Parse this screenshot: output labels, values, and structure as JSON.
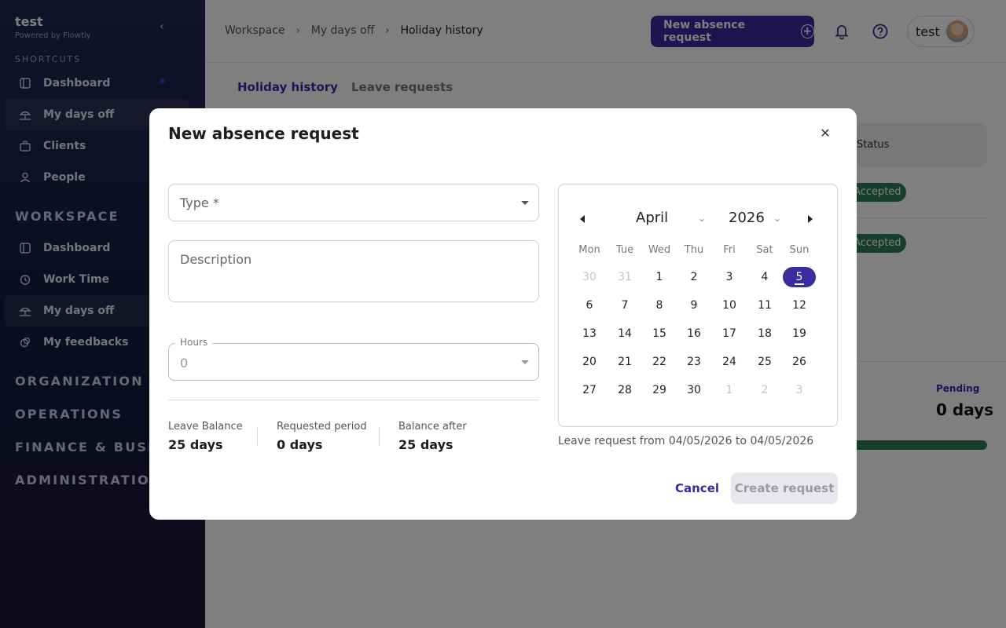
{
  "sidebar": {
    "brand": "test",
    "powered_by": "Powered by Flowtly",
    "shortcuts_label": "SHORTCUTS",
    "shortcuts": [
      {
        "label": "Dashboard",
        "icon": "dashboard-icon"
      },
      {
        "label": "My days off",
        "icon": "beach-icon"
      },
      {
        "label": "Clients",
        "icon": "briefcase-icon"
      },
      {
        "label": "People",
        "icon": "person-icon"
      }
    ],
    "workspace_label": "WORKSPACE",
    "workspace": [
      {
        "label": "Dashboard",
        "icon": "dashboard-icon"
      },
      {
        "label": "Work Time",
        "icon": "clock-icon"
      },
      {
        "label": "My days off",
        "icon": "beach-icon"
      },
      {
        "label": "My feedbacks",
        "icon": "feedback-icon"
      }
    ],
    "sections": [
      "ORGANIZATION",
      "OPERATIONS",
      "FINANCE & BUSINESS",
      "ADMINISTRATION"
    ]
  },
  "header": {
    "breadcrumbs": [
      "Workspace",
      "My days off",
      "Holiday history"
    ],
    "new_request_label": "New absence request",
    "user_name": "test"
  },
  "tabs": [
    "Holiday history",
    "Leave requests"
  ],
  "background": {
    "status_header": "Status",
    "status_rows": [
      "Accepted",
      "Accepted"
    ],
    "pending_label": "Pending",
    "pending_value": "0 days"
  },
  "modal": {
    "title": "New absence request",
    "type_placeholder": "Type *",
    "description_placeholder": "Description",
    "hours_label": "Hours",
    "hours_value": "0",
    "leave_balance_label": "Leave Balance",
    "leave_balance_value": "25 days",
    "requested_label": "Requested period",
    "requested_value": "0 days",
    "balance_after_label": "Balance after",
    "balance_after_value": "25 days",
    "calendar": {
      "month": "April",
      "year": "2026",
      "weekdays": [
        "Mon",
        "Tue",
        "Wed",
        "Thu",
        "Fri",
        "Sat",
        "Sun"
      ],
      "weeks": [
        [
          "30",
          "31",
          "1",
          "2",
          "3",
          "4",
          "5"
        ],
        [
          "6",
          "7",
          "8",
          "9",
          "10",
          "11",
          "12"
        ],
        [
          "13",
          "14",
          "15",
          "16",
          "17",
          "18",
          "19"
        ],
        [
          "20",
          "21",
          "22",
          "23",
          "24",
          "25",
          "26"
        ],
        [
          "27",
          "28",
          "29",
          "30",
          "1",
          "2",
          "3"
        ]
      ],
      "selected_day": "5"
    },
    "range_text": "Leave request from 04/05/2026 to 04/05/2026",
    "cancel_label": "Cancel",
    "create_label": "Create request"
  }
}
